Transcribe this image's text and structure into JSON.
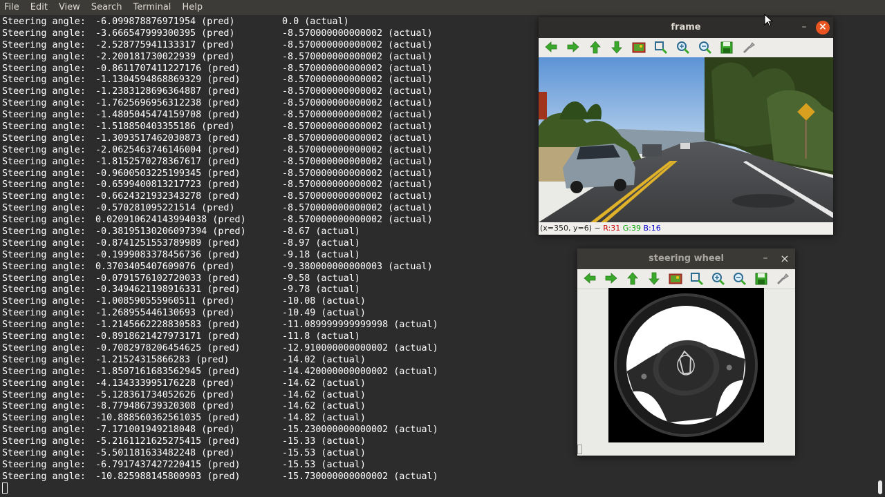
{
  "menubar": {
    "items": [
      "File",
      "Edit",
      "View",
      "Search",
      "Terminal",
      "Help"
    ]
  },
  "terminal": {
    "label": "Steering angle:",
    "lines": [
      {
        "pred": "-6.099878876971954 (pred)",
        "actual": "0.0 (actual)"
      },
      {
        "pred": "-3.666547999300395 (pred)",
        "actual": "-8.570000000000002 (actual)"
      },
      {
        "pred": "-2.528775941133317 (pred)",
        "actual": "-8.570000000000002 (actual)"
      },
      {
        "pred": "-2.200181730022939 (pred)",
        "actual": "-8.570000000000002 (actual)"
      },
      {
        "pred": "-0.8611707411227176 (pred)",
        "actual": "-8.570000000000002 (actual)"
      },
      {
        "pred": "-1.1304594868869329 (pred)",
        "actual": "-8.570000000000002 (actual)"
      },
      {
        "pred": "-1.2383128696364887 (pred)",
        "actual": "-8.570000000000002 (actual)"
      },
      {
        "pred": "-1.7625696956312238 (pred)",
        "actual": "-8.570000000000002 (actual)"
      },
      {
        "pred": "-1.4805045474159708 (pred)",
        "actual": "-8.570000000000002 (actual)"
      },
      {
        "pred": "-1.518850403355186 (pred)",
        "actual": "-8.570000000000002 (actual)"
      },
      {
        "pred": "-1.3093517462030873 (pred)",
        "actual": "-8.570000000000002 (actual)"
      },
      {
        "pred": "-2.0625463746146004 (pred)",
        "actual": "-8.570000000000002 (actual)"
      },
      {
        "pred": "-1.8152570278367617 (pred)",
        "actual": "-8.570000000000002 (actual)"
      },
      {
        "pred": "-0.9600503225199345 (pred)",
        "actual": "-8.570000000000002 (actual)"
      },
      {
        "pred": "-0.6599400813217723 (pred)",
        "actual": "-8.570000000000002 (actual)"
      },
      {
        "pred": "-0.6624321932343278 (pred)",
        "actual": "-8.570000000000002 (actual)"
      },
      {
        "pred": "-0.570281095221514 (pred)",
        "actual": "-8.570000000000002 (actual)"
      },
      {
        "pred": "0.020910624143994038 (pred)",
        "actual": "-8.570000000000002 (actual)"
      },
      {
        "pred": "-0.38195130206097394 (pred)",
        "actual": "-8.67 (actual)"
      },
      {
        "pred": "-0.8741251553789989 (pred)",
        "actual": "-8.97 (actual)"
      },
      {
        "pred": "-0.1999083378456736 (pred)",
        "actual": "-9.18 (actual)"
      },
      {
        "pred": "0.3703405407609076 (pred)",
        "actual": "-9.380000000000003 (actual)"
      },
      {
        "pred": "-0.0791576102720033 (pred)",
        "actual": "-9.58 (actual)"
      },
      {
        "pred": "-0.3494621198916331 (pred)",
        "actual": "-9.78 (actual)"
      },
      {
        "pred": "-1.008590555960511 (pred)",
        "actual": "-10.08 (actual)"
      },
      {
        "pred": "-1.268955446130693 (pred)",
        "actual": "-10.49 (actual)"
      },
      {
        "pred": "-1.2145662228830583 (pred)",
        "actual": "-11.089999999999998 (actual)"
      },
      {
        "pred": "-0.8918621427973171 (pred)",
        "actual": "-11.8 (actual)"
      },
      {
        "pred": "-0.7082978206454625 (pred)",
        "actual": "-12.910000000000002 (actual)"
      },
      {
        "pred": "-1.21524315866283 (pred)",
        "actual": "-14.02 (actual)"
      },
      {
        "pred": "-1.8507161683562945 (pred)",
        "actual": "-14.420000000000002 (actual)"
      },
      {
        "pred": "-4.134333995176228 (pred)",
        "actual": "-14.62 (actual)"
      },
      {
        "pred": "-5.128361734052626 (pred)",
        "actual": "-14.62 (actual)"
      },
      {
        "pred": "-8.779486739320308 (pred)",
        "actual": "-14.62 (actual)"
      },
      {
        "pred": "-10.888560362561035 (pred)",
        "actual": "-14.82 (actual)"
      },
      {
        "pred": "-7.171001949218048 (pred)",
        "actual": "-15.230000000000002 (actual)"
      },
      {
        "pred": "-5.2161121625275415 (pred)",
        "actual": "-15.33 (actual)"
      },
      {
        "pred": "-5.501181633482248 (pred)",
        "actual": "-15.53 (actual)"
      },
      {
        "pred": "-6.7917437427220415 (pred)",
        "actual": "-15.53 (actual)"
      },
      {
        "pred": "-10.825988145800903 (pred)",
        "actual": "-15.730000000000002 (actual)"
      }
    ]
  },
  "frame_window": {
    "title": "frame",
    "status_prefix": "(x=350, y=6) ~ ",
    "r": "R:31",
    "g": "G:39",
    "b": "B:16",
    "close_glyph": "×",
    "min_glyph": "–"
  },
  "wheel_window": {
    "title": "steering wheel",
    "close_glyph": "×",
    "min_glyph": "–"
  },
  "toolbar_icons": [
    "arrow-left-icon",
    "arrow-right-icon",
    "arrow-up-icon",
    "arrow-down-icon",
    "image-icon",
    "zoom-fit-icon",
    "zoom-in-icon",
    "zoom-out-icon",
    "save-icon",
    "settings-icon"
  ],
  "colors": {
    "accent": "#e95420",
    "terminal_bg": "#2c2c2c",
    "toolbar_green": "#3aa82a"
  }
}
